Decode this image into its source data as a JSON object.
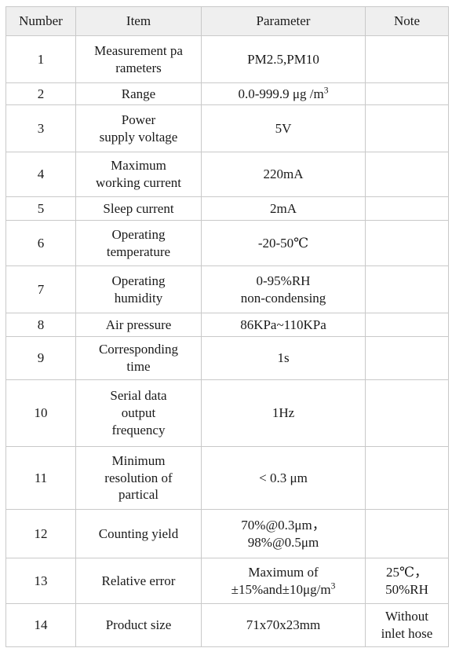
{
  "table": {
    "columns": [
      "Number",
      "Item",
      "Parameter",
      "Note"
    ],
    "rows": [
      {
        "number": "1",
        "item": "Measurement pa rameters",
        "item_lines": [
          "Measurement pa",
          "rameters"
        ],
        "parameter": "PM2.5,PM10",
        "parameter_lines": [
          "PM2.5,PM10"
        ],
        "note": ""
      },
      {
        "number": "2",
        "item": "Range",
        "item_lines": [
          "Range"
        ],
        "parameter": "0.0-999.9 μg /m3",
        "parameter_lines": [
          "0.0-999.9 μg /m³"
        ],
        "note": ""
      },
      {
        "number": "3",
        "item": "Power supply voltage",
        "item_lines": [
          "Power",
          "supply voltage"
        ],
        "parameter": "5V",
        "parameter_lines": [
          "5V"
        ],
        "note": ""
      },
      {
        "number": "4",
        "item": "Maximum working current",
        "item_lines": [
          "Maximum",
          "working current"
        ],
        "parameter": "220mA",
        "parameter_lines": [
          "220mA"
        ],
        "note": ""
      },
      {
        "number": "5",
        "item": "Sleep current",
        "item_lines": [
          "Sleep current"
        ],
        "parameter": "2mA",
        "parameter_lines": [
          "2mA"
        ],
        "note": ""
      },
      {
        "number": "6",
        "item": "Operating temperature",
        "item_lines": [
          "Operating",
          "temperature"
        ],
        "parameter": "-20-50℃",
        "parameter_lines": [
          "-20-50℃"
        ],
        "note": ""
      },
      {
        "number": "7",
        "item": "Operating humidity",
        "item_lines": [
          "Operating",
          "humidity"
        ],
        "parameter": "0-95%RH non-condensing",
        "parameter_lines": [
          "0-95%RH",
          "non-condensing"
        ],
        "note": ""
      },
      {
        "number": "8",
        "item": "Air pressure",
        "item_lines": [
          "Air pressure"
        ],
        "parameter": "86KPa~110KPa",
        "parameter_lines": [
          "86KPa~110KPa"
        ],
        "note": ""
      },
      {
        "number": "9",
        "item": "Corresponding time",
        "item_lines": [
          "Corresponding",
          "time"
        ],
        "parameter": "1s",
        "parameter_lines": [
          "1s"
        ],
        "note": ""
      },
      {
        "number": "10",
        "item": "Serial data output frequency",
        "item_lines": [
          "Serial data",
          "output",
          "frequency"
        ],
        "parameter": "1Hz",
        "parameter_lines": [
          "1Hz"
        ],
        "note": ""
      },
      {
        "number": "11",
        "item": "Minimum resolution of partical",
        "item_lines": [
          "Minimum",
          "resolution of",
          "partical"
        ],
        "parameter": "< 0.3 μm",
        "parameter_lines": [
          "< 0.3 μm"
        ],
        "note": ""
      },
      {
        "number": "12",
        "item": "Counting yield",
        "item_lines": [
          "Counting yield"
        ],
        "parameter": "70%@0.3μm，98%@0.5μm",
        "parameter_lines": [
          "70%@0.3μm，",
          "98%@0.5μm"
        ],
        "note": ""
      },
      {
        "number": "13",
        "item": "Relative error",
        "item_lines": [
          "Relative error"
        ],
        "parameter": "Maximum of ±15%and±10μg/m3",
        "parameter_lines": [
          "Maximum of",
          "±15%and±10μg/m³"
        ],
        "note": "25℃, 50%RH",
        "note_lines": [
          "25℃，",
          "50%RH"
        ]
      },
      {
        "number": "14",
        "item": "Product size",
        "item_lines": [
          "Product size"
        ],
        "parameter": "71x70x23mm",
        "parameter_lines": [
          "71x70x23mm"
        ],
        "note": "Without inlet hose",
        "note_lines": [
          "Without",
          "inlet hose"
        ]
      }
    ]
  },
  "colors": {
    "header_background": "#efefef",
    "border": "#c9c9c9",
    "text": "#1a1a1a",
    "page_background": "#ffffff"
  }
}
